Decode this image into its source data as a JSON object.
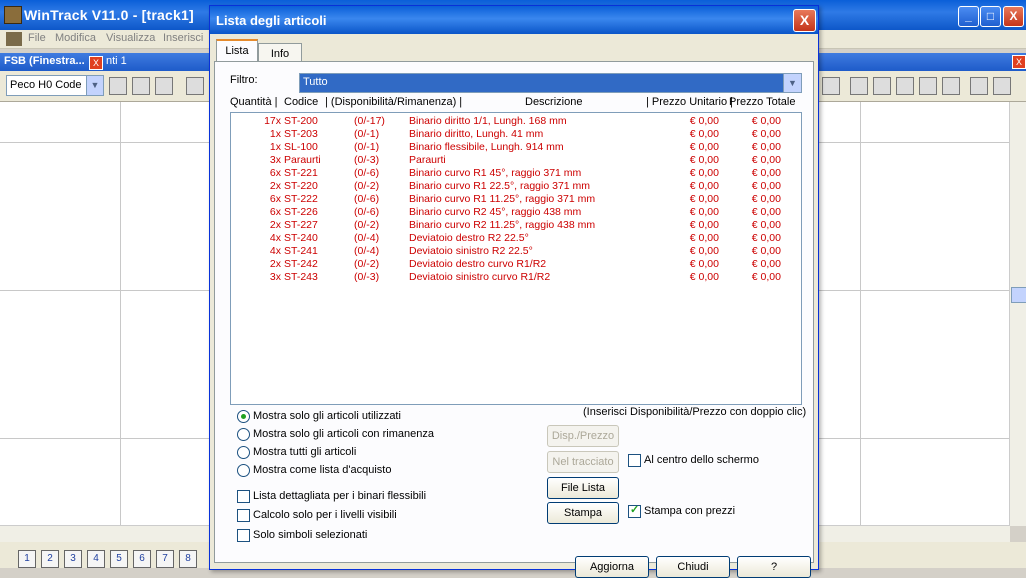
{
  "app": {
    "title": "WinTrack  V11.0 - [track1]",
    "menu": [
      "File",
      "Modifica",
      "Visualizza",
      "Inserisci"
    ],
    "fsb_title": "FSB (Finestra...",
    "fsb_title_right": "nti 1",
    "track_system": "Peco H0 Code",
    "pages": [
      "1",
      "2",
      "3",
      "4",
      "5",
      "6",
      "7",
      "8"
    ],
    "min_label": "_",
    "max_label": "□",
    "close_label": "X"
  },
  "dialog": {
    "title": "Lista degli articoli",
    "close_label": "X",
    "tabs": [
      "Lista",
      "Info"
    ],
    "filter_label": "Filtro:",
    "filter_value": "Tutto",
    "columns": {
      "qty": "Quantità |",
      "code": "Codice",
      "avail": "| (Disponibilità/Rimanenza) |",
      "desc": "Descrizione",
      "price": "| Prezzo Unitario |",
      "total": "Prezzo Totale"
    },
    "rows": [
      {
        "qty": "17x",
        "code": "ST-200",
        "avail": "(0/-17)",
        "desc": "Binario diritto 1/1, Lungh. 168 mm",
        "price": "€ 0,00",
        "total": "€ 0,00"
      },
      {
        "qty": "1x",
        "code": "ST-203",
        "avail": "(0/-1)",
        "desc": "Binario diritto, Lungh. 41 mm",
        "price": "€ 0,00",
        "total": "€ 0,00"
      },
      {
        "qty": "1x",
        "code": "SL-100",
        "avail": "(0/-1)",
        "desc": "Binario flessibile, Lungh. 914 mm",
        "price": "€ 0,00",
        "total": "€ 0,00"
      },
      {
        "qty": "3x",
        "code": "Paraurti",
        "avail": "(0/-3)",
        "desc": "Paraurti",
        "price": "€ 0,00",
        "total": "€ 0,00"
      },
      {
        "qty": "6x",
        "code": "ST-221",
        "avail": "(0/-6)",
        "desc": "Binario curvo R1 45°, raggio 371 mm",
        "price": "€ 0,00",
        "total": "€ 0,00"
      },
      {
        "qty": "2x",
        "code": "ST-220",
        "avail": "(0/-2)",
        "desc": "Binario curvo R1 22.5°, raggio 371 mm",
        "price": "€ 0,00",
        "total": "€ 0,00"
      },
      {
        "qty": "6x",
        "code": "ST-222",
        "avail": "(0/-6)",
        "desc": "Binario curvo R1 11.25°, raggio 371 mm",
        "price": "€ 0,00",
        "total": "€ 0,00"
      },
      {
        "qty": "6x",
        "code": "ST-226",
        "avail": "(0/-6)",
        "desc": "Binario curvo R2 45°, raggio 438 mm",
        "price": "€ 0,00",
        "total": "€ 0,00"
      },
      {
        "qty": "2x",
        "code": "ST-227",
        "avail": "(0/-2)",
        "desc": "Binario curvo R2 11.25°, raggio 438 mm",
        "price": "€ 0,00",
        "total": "€ 0,00"
      },
      {
        "qty": "4x",
        "code": "ST-240",
        "avail": "(0/-4)",
        "desc": "Deviatoio destro R2 22.5°",
        "price": "€ 0,00",
        "total": "€ 0,00"
      },
      {
        "qty": "4x",
        "code": "ST-241",
        "avail": "(0/-4)",
        "desc": "Deviatoio sinistro R2 22.5°",
        "price": "€ 0,00",
        "total": "€ 0,00"
      },
      {
        "qty": "2x",
        "code": "ST-242",
        "avail": "(0/-2)",
        "desc": "Deviatoio destro curvo R1/R2",
        "price": "€ 0,00",
        "total": "€ 0,00"
      },
      {
        "qty": "3x",
        "code": "ST-243",
        "avail": "(0/-3)",
        "desc": "Deviatoio sinistro curvo R1/R2",
        "price": "€ 0,00",
        "total": "€ 0,00"
      }
    ],
    "hint": "(Inserisci Disponibilità/Prezzo con doppio clic)",
    "radios": [
      {
        "label": "Mostra solo gli articoli utilizzati",
        "checked": true
      },
      {
        "label": "Mostra solo gli articoli con rimanenza",
        "checked": false
      },
      {
        "label": "Mostra tutti gli articoli",
        "checked": false
      },
      {
        "label": "Mostra come lista d'acquisto",
        "checked": false
      }
    ],
    "checks": [
      {
        "label": "Lista dettagliata per i binari flessibili",
        "checked": false
      },
      {
        "label": "Calcolo solo per i livelli visibili",
        "checked": false
      },
      {
        "label": "Solo simboli selezionati",
        "checked": false
      }
    ],
    "buttons": {
      "disp_prezzo": "Disp./Prezzo",
      "nel_tracciato": "Nel tracciato",
      "file_lista": "File Lista",
      "stampa": "Stampa",
      "aggiorna": "Aggiorna",
      "chiudi": "Chiudi",
      "help": "?"
    },
    "center_screen": {
      "label": "Al centro dello schermo",
      "checked": false
    },
    "print_prices": {
      "label": "Stampa con prezzi",
      "checked": true
    }
  }
}
